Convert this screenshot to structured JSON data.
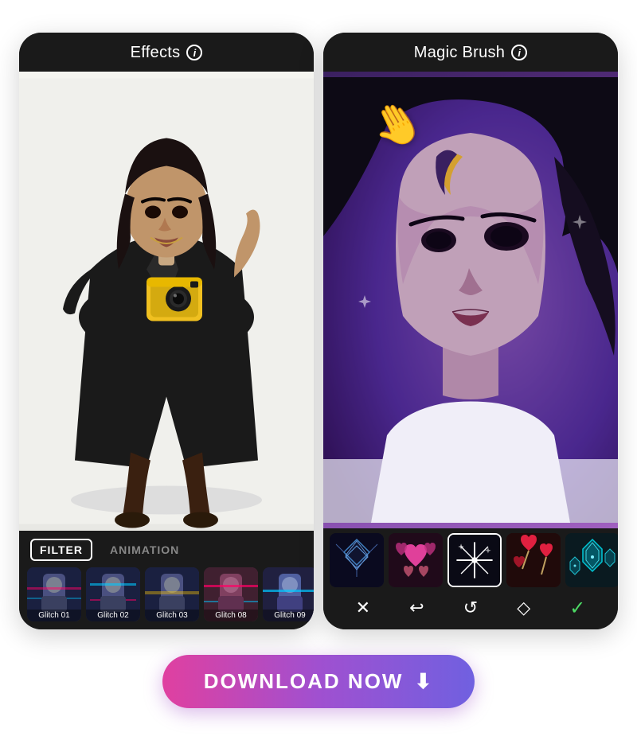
{
  "left_phone": {
    "header_title": "Effects",
    "info_icon": "i",
    "tabs": [
      {
        "id": "filter",
        "label": "FILTER",
        "active": true
      },
      {
        "id": "animation",
        "label": "ANIMATION",
        "active": false
      }
    ],
    "filters": [
      {
        "id": "glitch01",
        "label": "Glitch 01",
        "class": "glitch01"
      },
      {
        "id": "glitch02",
        "label": "Glitch 02",
        "class": "glitch02"
      },
      {
        "id": "glitch03",
        "label": "Glitch 03",
        "class": "glitch03"
      },
      {
        "id": "glitch08",
        "label": "Glitch 08",
        "class": "glitch08"
      },
      {
        "id": "glitch09",
        "label": "Glitch 09",
        "class": "glitch09"
      }
    ]
  },
  "right_phone": {
    "header_title": "Magic Brush",
    "info_icon": "i",
    "brushes": [
      {
        "id": "geo",
        "label": "geometric",
        "class": "brush-geo",
        "selected": false
      },
      {
        "id": "hearts-pink",
        "label": "pink hearts",
        "class": "brush-hearts-pink",
        "selected": false
      },
      {
        "id": "stars",
        "label": "stars sparkle",
        "class": "brush-stars",
        "selected": true
      },
      {
        "id": "hearts-red",
        "label": "red hearts",
        "class": "brush-hearts-red",
        "selected": false
      },
      {
        "id": "cyan",
        "label": "cyan gems",
        "class": "brush-cyan",
        "selected": false
      }
    ],
    "actions": [
      {
        "id": "close",
        "icon": "✕",
        "label": "close"
      },
      {
        "id": "undo",
        "icon": "↩",
        "label": "undo"
      },
      {
        "id": "reset",
        "icon": "↺",
        "label": "reset"
      },
      {
        "id": "erase",
        "icon": "◇",
        "label": "erase"
      },
      {
        "id": "confirm",
        "icon": "✓",
        "label": "confirm",
        "accent": true
      }
    ]
  },
  "download_button": {
    "label": "DOWNLOAD NOW",
    "icon": "⬇"
  }
}
